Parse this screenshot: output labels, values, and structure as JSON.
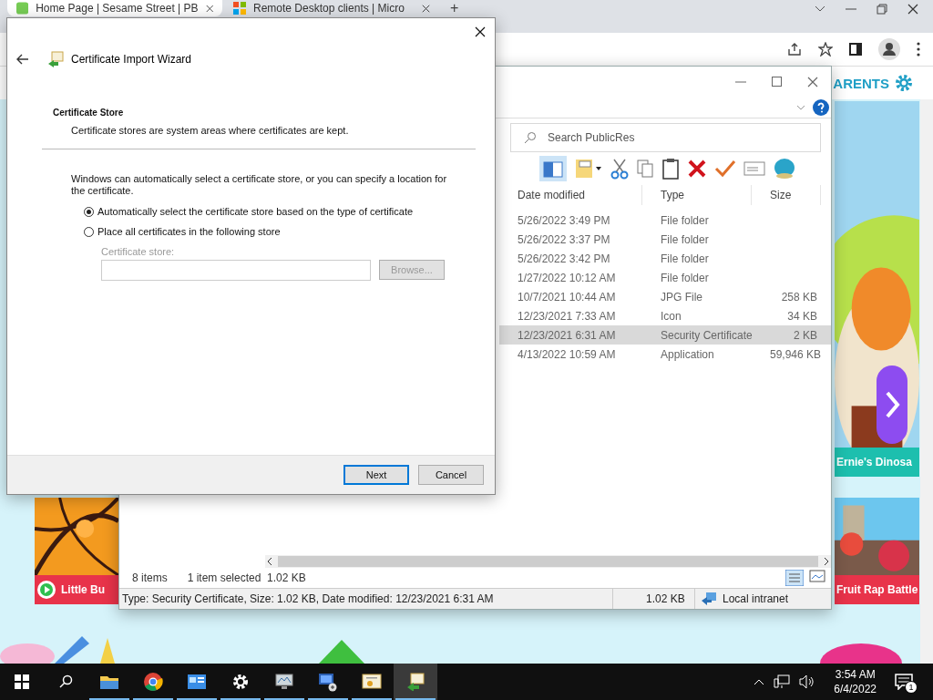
{
  "browser": {
    "tabs": [
      {
        "title": "Home Page | Sesame Street | PB",
        "selected": true
      },
      {
        "title": "Remote Desktop clients | Micro",
        "selected": false
      }
    ],
    "new_tab": "+"
  },
  "site": {
    "header_link": "ARENTS",
    "cards": [
      {
        "title": "Ernie's Dinosa",
        "color": "#1dbfae"
      },
      {
        "title": "Little Bu",
        "color": "#e8334a"
      },
      {
        "title": "Fruit Rap Battle",
        "color": "#e8334a"
      }
    ]
  },
  "explorer": {
    "search": {
      "placeholder": "Search PublicRes"
    },
    "columns": [
      "Date modified",
      "Type",
      "Size"
    ],
    "rows": [
      {
        "date": "5/26/2022 3:49 PM",
        "type": "File folder",
        "size": "",
        "selected": false
      },
      {
        "date": "5/26/2022 3:37 PM",
        "type": "File folder",
        "size": "",
        "selected": false
      },
      {
        "date": "5/26/2022 3:42 PM",
        "type": "File folder",
        "size": "",
        "selected": false
      },
      {
        "date": "1/27/2022 10:12 AM",
        "type": "File folder",
        "size": "",
        "selected": false
      },
      {
        "date": "10/7/2021 10:44 AM",
        "type": "JPG File",
        "size": "258 KB",
        "selected": false
      },
      {
        "date": "12/23/2021 7:33 AM",
        "type": "Icon",
        "size": "34 KB",
        "selected": false
      },
      {
        "date": "12/23/2021 6:31 AM",
        "type": "Security Certificate",
        "size": "2 KB",
        "selected": true
      },
      {
        "date": "4/13/2022 10:59 AM",
        "type": "Application",
        "size": "59,946 KB",
        "selected": false
      }
    ],
    "status": {
      "items": "8 items",
      "selection": "1 item selected  1.02 KB"
    },
    "details_bar": {
      "summary": "Type: Security Certificate, Size: 1.02 KB, Date modified: 12/23/2021 6:31 AM",
      "size": "1.02 KB",
      "zone": "Local intranet"
    }
  },
  "dialog": {
    "title": "Certificate Import Wizard",
    "section_title": "Certificate Store",
    "section_subtitle": "Certificate stores are system areas where certificates are kept.",
    "intro": "Windows can automatically select a certificate store, or you can specify a location for the certificate.",
    "options": [
      {
        "label": "Automatically select the certificate store based on the type of certificate",
        "selected": true
      },
      {
        "label": "Place all certificates in the following store",
        "selected": false
      }
    ],
    "store_label": "Certificate store:",
    "store_field": {
      "disabled": true
    },
    "browse": {
      "label": "Browse...",
      "disabled": true
    },
    "buttons": [
      {
        "label": "Next",
        "default": true
      },
      {
        "label": "Cancel",
        "default": false
      }
    ]
  },
  "taskbar": {
    "apps": [
      {
        "kind": "folder",
        "selected": false
      },
      {
        "kind": "chrome",
        "selected": false
      },
      {
        "kind": "panel",
        "selected": false
      },
      {
        "kind": "gear",
        "selected": false
      },
      {
        "kind": "monitor",
        "selected": false
      },
      {
        "kind": "remote",
        "selected": false
      },
      {
        "kind": "certificate",
        "selected": false
      },
      {
        "kind": "wizard",
        "selected": true
      }
    ],
    "time": "3:54 AM",
    "date": "6/4/2022",
    "notifications": "1"
  }
}
